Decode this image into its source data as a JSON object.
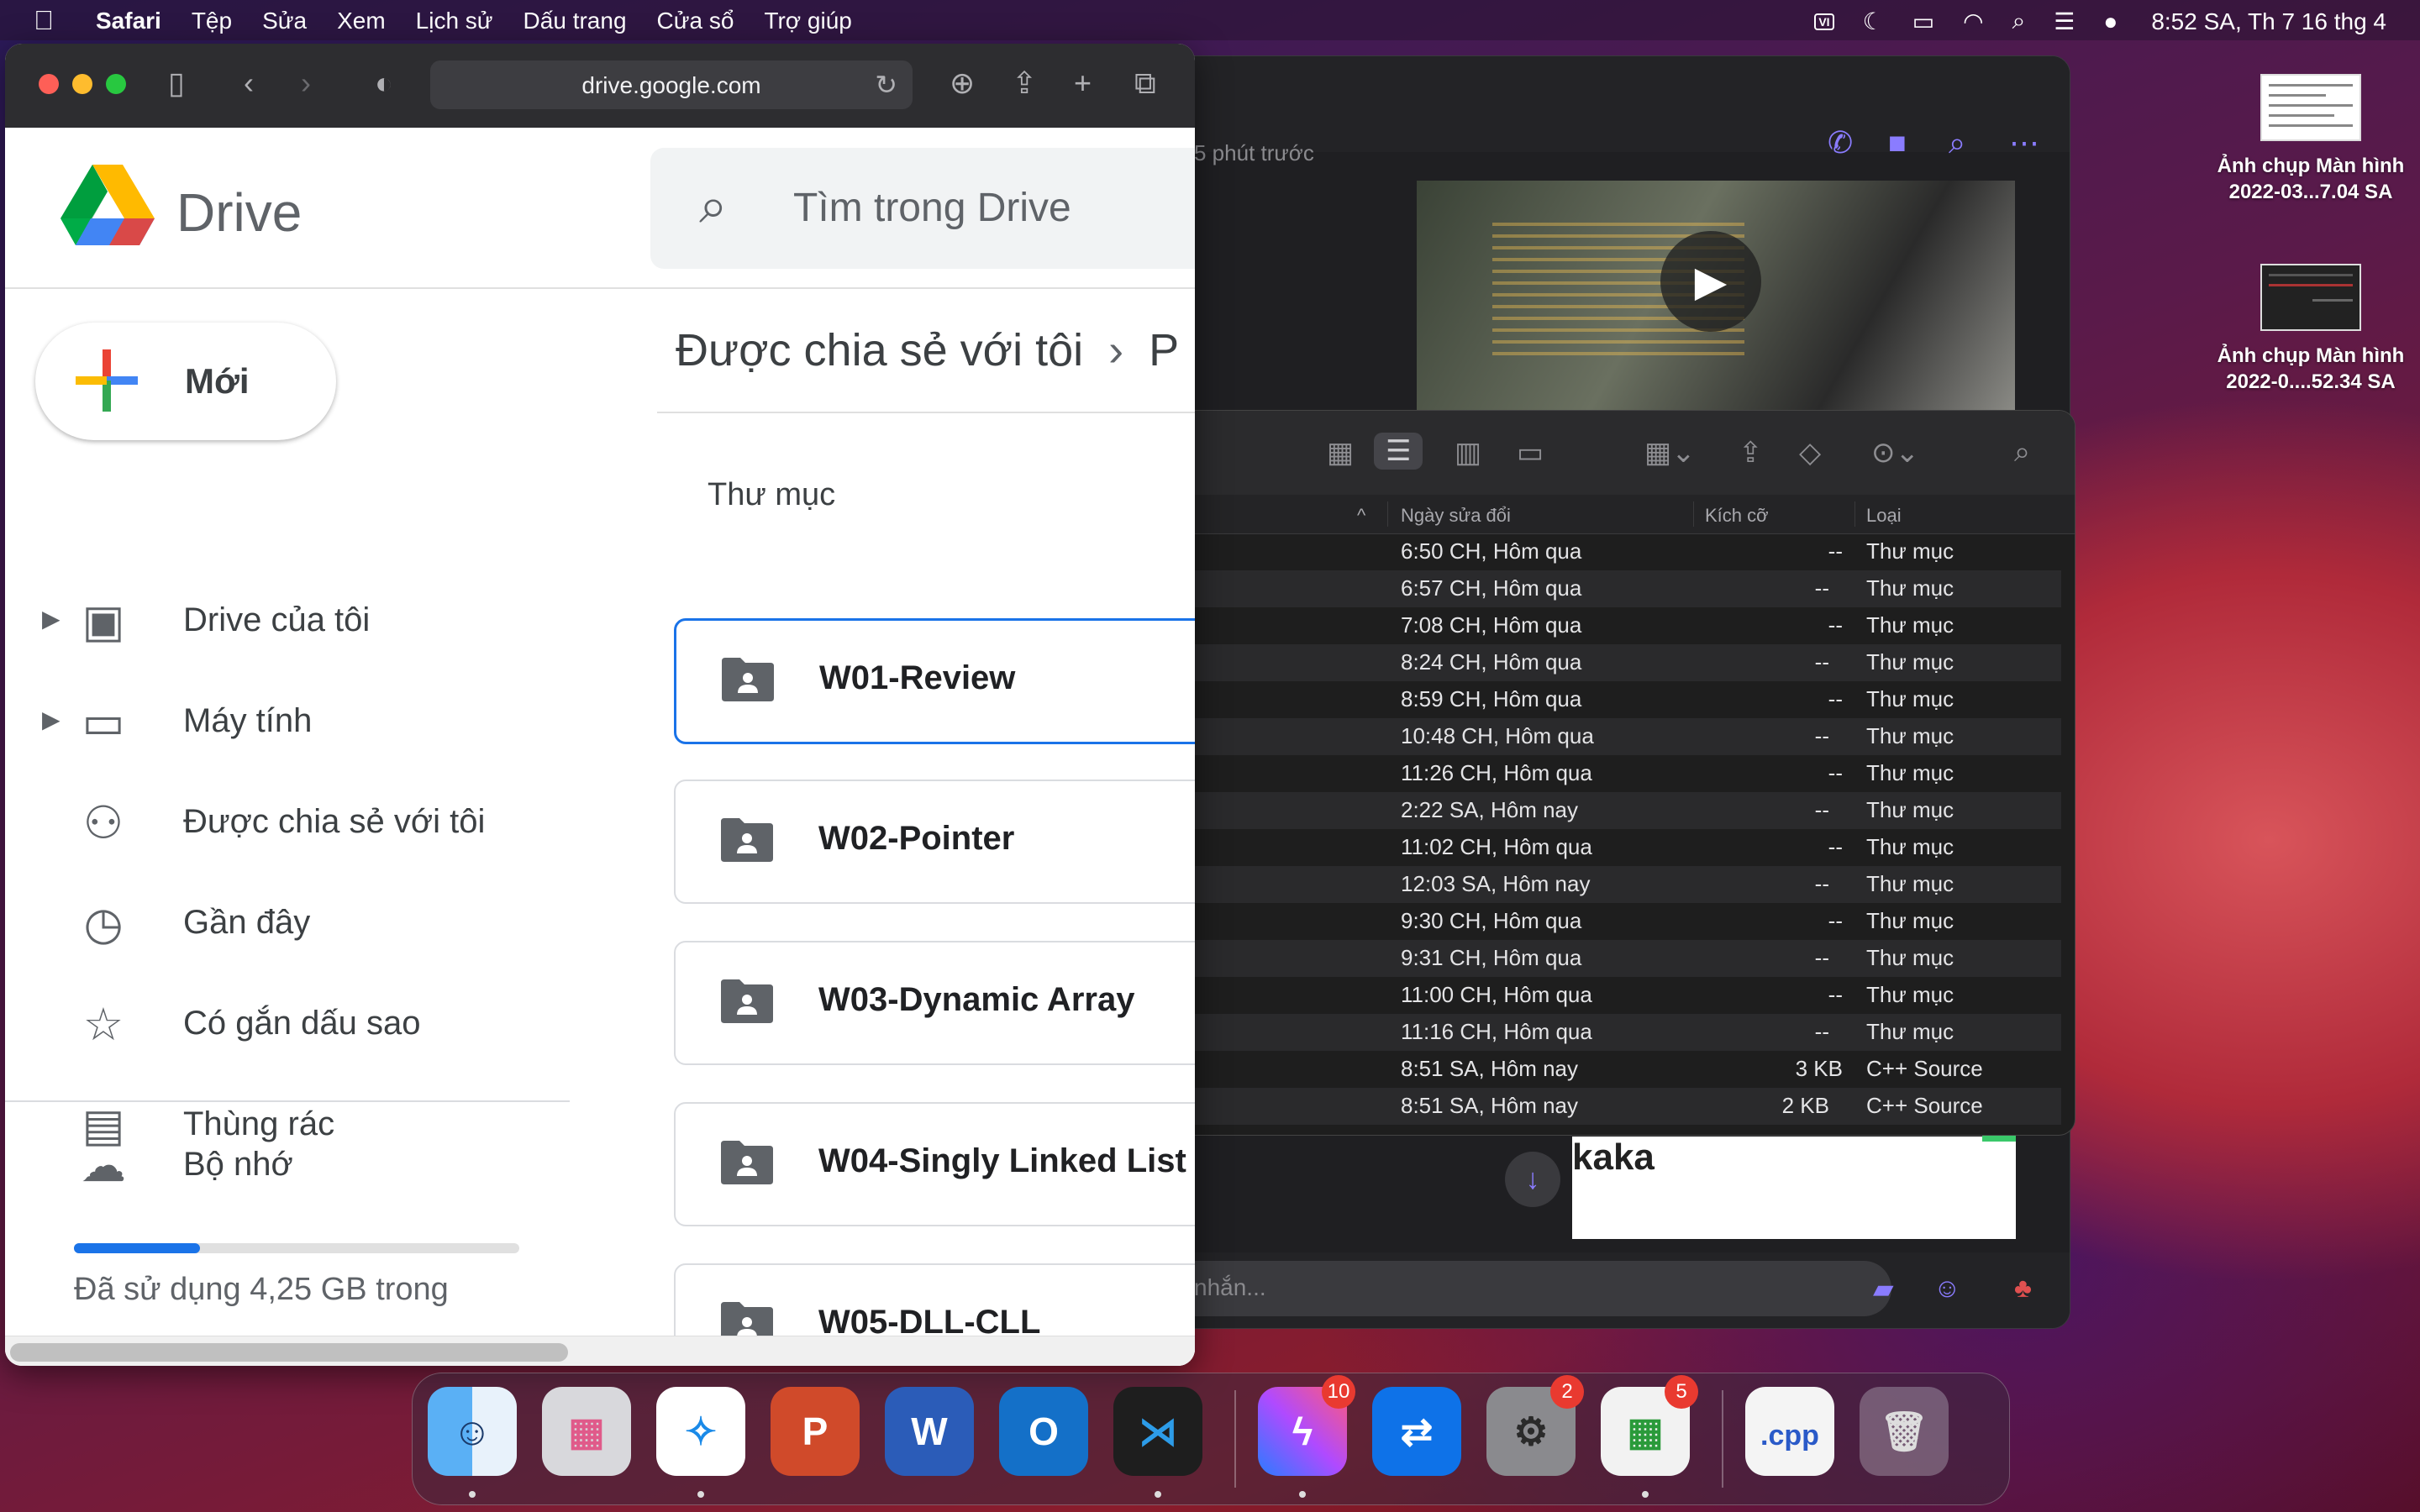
{
  "menubar": {
    "app_name": "Safari",
    "menus": [
      "Tệp",
      "Sửa",
      "Xem",
      "Lịch sử",
      "Dấu trang",
      "Cửa sổ",
      "Trợ giúp"
    ],
    "keyboard_label": "VI",
    "clock": "8:52 SA, Th 7 16 thg 4"
  },
  "desktop": {
    "icons": [
      {
        "label_line1": "Ảnh chụp Màn hình",
        "label_line2": "2022-03...7.04 SA"
      },
      {
        "label_line1": "Ảnh chụp Màn hình",
        "label_line2": "2022-0....52.34 SA"
      }
    ]
  },
  "messenger": {
    "timestamp": "5 phút trước",
    "card_text": "kaka",
    "input_placeholder": "nhắn..."
  },
  "finder": {
    "columns": {
      "name": "^",
      "date": "Ngày sửa đổi",
      "size": "Kích cỡ",
      "kind": "Loại"
    },
    "rows": [
      {
        "date": "6:50 CH, Hôm qua",
        "size": "--",
        "kind": "Thư mục"
      },
      {
        "date": "6:57 CH, Hôm qua",
        "size": "--",
        "kind": "Thư mục"
      },
      {
        "date": "7:08 CH, Hôm qua",
        "size": "--",
        "kind": "Thư mục"
      },
      {
        "date": "8:24 CH, Hôm qua",
        "size": "--",
        "kind": "Thư mục"
      },
      {
        "date": "8:59 CH, Hôm qua",
        "size": "--",
        "kind": "Thư mục"
      },
      {
        "date": "10:48 CH, Hôm qua",
        "size": "--",
        "kind": "Thư mục"
      },
      {
        "date": "11:26 CH, Hôm qua",
        "size": "--",
        "kind": "Thư mục"
      },
      {
        "date": "2:22 SA, Hôm nay",
        "size": "--",
        "kind": "Thư mục"
      },
      {
        "date": "11:02 CH, Hôm qua",
        "size": "--",
        "kind": "Thư mục"
      },
      {
        "date": "12:03 SA, Hôm nay",
        "size": "--",
        "kind": "Thư mục"
      },
      {
        "date": "9:30 CH, Hôm qua",
        "size": "--",
        "kind": "Thư mục"
      },
      {
        "date": "9:31 CH, Hôm qua",
        "size": "--",
        "kind": "Thư mục"
      },
      {
        "date": "11:00 CH, Hôm qua",
        "size": "--",
        "kind": "Thư mục"
      },
      {
        "date": "11:16 CH, Hôm qua",
        "size": "--",
        "kind": "Thư mục"
      },
      {
        "date": "8:51 SA, Hôm nay",
        "size": "3 KB",
        "kind": "C++ Source"
      },
      {
        "date": "8:51 SA, Hôm nay",
        "size": "2 KB",
        "kind": "C++ Source"
      }
    ]
  },
  "safari": {
    "url": "drive.google.com"
  },
  "drive": {
    "brand": "Drive",
    "search_placeholder": "Tìm trong Drive",
    "new_button": "Mới",
    "nav": [
      {
        "label": "Drive của tôi",
        "icon": "my-drive-icon"
      },
      {
        "label": "Máy tính",
        "icon": "computers-icon"
      },
      {
        "label": "Được chia sẻ với tôi",
        "icon": "shared-icon"
      },
      {
        "label": "Gần đây",
        "icon": "clock-icon"
      },
      {
        "label": "Có gắn dấu sao",
        "icon": "star-icon"
      },
      {
        "label": "Thùng rác",
        "icon": "trash-icon"
      }
    ],
    "storage": {
      "label": "Bộ nhớ",
      "used_text": "Đã sử dụng 4,25 GB trong",
      "used_fraction": 0.283
    },
    "breadcrumb": {
      "parent": "Được chia sẻ với tôi",
      "current": "P"
    },
    "section_title": "Thư mục",
    "folders": [
      "W01-Review",
      "W02-Pointer",
      "W03-Dynamic Array",
      "W04-Singly Linked List",
      "W05-DLL-CLL"
    ]
  },
  "dock": {
    "apps": [
      {
        "name": "Finder",
        "badge": ""
      },
      {
        "name": "Launchpad",
        "badge": ""
      },
      {
        "name": "Safari",
        "badge": ""
      },
      {
        "name": "PowerPoint",
        "badge": ""
      },
      {
        "name": "Word",
        "badge": ""
      },
      {
        "name": "Outlook",
        "badge": ""
      },
      {
        "name": "Visual Studio Code",
        "badge": ""
      },
      {
        "name": "Messenger",
        "badge": "10"
      },
      {
        "name": "TeamViewer",
        "badge": ""
      },
      {
        "name": "System Preferences",
        "badge": "2"
      },
      {
        "name": "Microsoft Store",
        "badge": "5"
      },
      {
        "name": "cpp file",
        "badge": "",
        "label": ".cpp"
      },
      {
        "name": "Trash",
        "badge": ""
      }
    ]
  },
  "colors": {
    "drive_blue": "#1a73e8",
    "badge_red": "#e93a30",
    "messenger_purple": "#8a7cff"
  }
}
